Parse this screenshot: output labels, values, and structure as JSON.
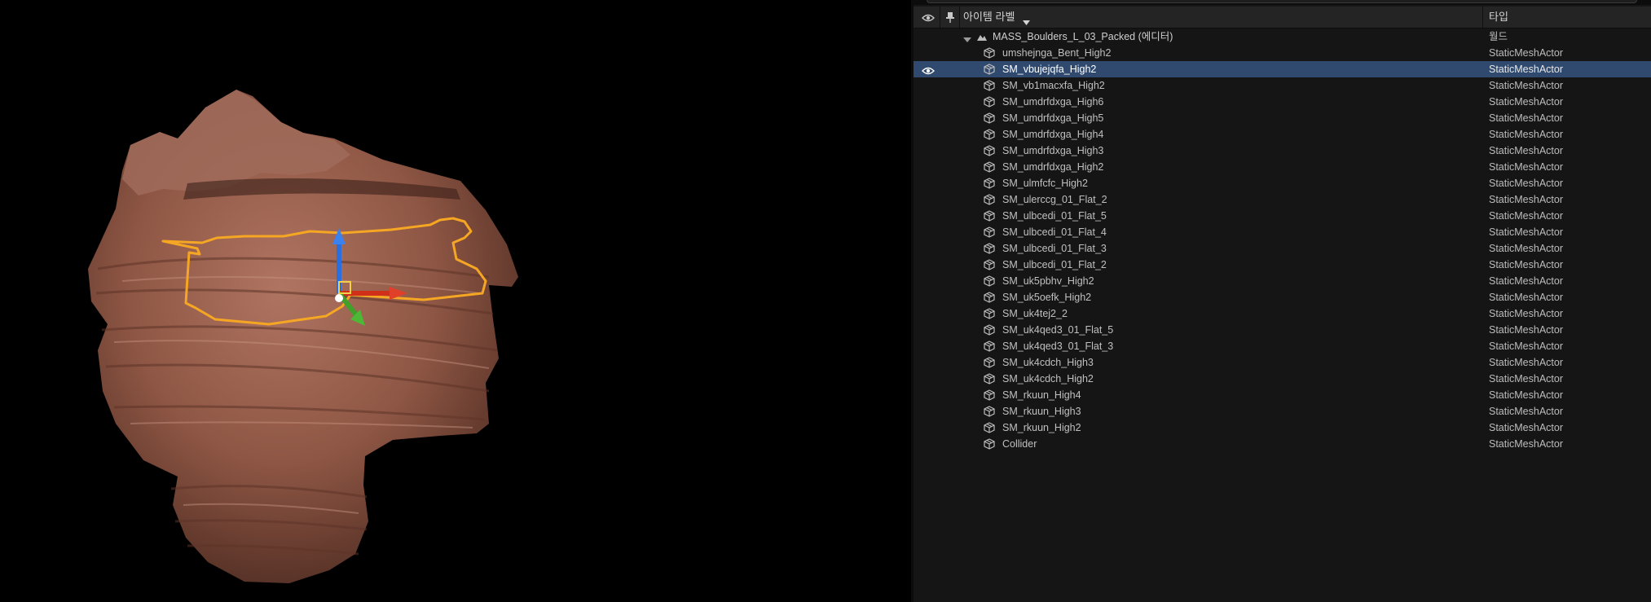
{
  "outliner": {
    "header": {
      "label_column": "아이템 라벨",
      "type_column": "타입"
    },
    "world_row": {
      "label": "MASS_Boulders_L_03_Packed (에디터)",
      "type": "월드"
    },
    "rows": [
      {
        "label": "umshejnga_Bent_High2",
        "type": "StaticMeshActor",
        "selected": false
      },
      {
        "label": "SM_vbujejqfa_High2",
        "type": "StaticMeshActor",
        "selected": true
      },
      {
        "label": "SM_vb1macxfa_High2",
        "type": "StaticMeshActor",
        "selected": false
      },
      {
        "label": "SM_umdrfdxga_High6",
        "type": "StaticMeshActor",
        "selected": false
      },
      {
        "label": "SM_umdrfdxga_High5",
        "type": "StaticMeshActor",
        "selected": false
      },
      {
        "label": "SM_umdrfdxga_High4",
        "type": "StaticMeshActor",
        "selected": false
      },
      {
        "label": "SM_umdrfdxga_High3",
        "type": "StaticMeshActor",
        "selected": false
      },
      {
        "label": "SM_umdrfdxga_High2",
        "type": "StaticMeshActor",
        "selected": false
      },
      {
        "label": "SM_ulmfcfc_High2",
        "type": "StaticMeshActor",
        "selected": false
      },
      {
        "label": "SM_ulerccg_01_Flat_2",
        "type": "StaticMeshActor",
        "selected": false
      },
      {
        "label": "SM_ulbcedi_01_Flat_5",
        "type": "StaticMeshActor",
        "selected": false
      },
      {
        "label": "SM_ulbcedi_01_Flat_4",
        "type": "StaticMeshActor",
        "selected": false
      },
      {
        "label": "SM_ulbcedi_01_Flat_3",
        "type": "StaticMeshActor",
        "selected": false
      },
      {
        "label": "SM_ulbcedi_01_Flat_2",
        "type": "StaticMeshActor",
        "selected": false
      },
      {
        "label": "SM_uk5pbhv_High2",
        "type": "StaticMeshActor",
        "selected": false
      },
      {
        "label": "SM_uk5oefk_High2",
        "type": "StaticMeshActor",
        "selected": false
      },
      {
        "label": "SM_uk4tej2_2",
        "type": "StaticMeshActor",
        "selected": false
      },
      {
        "label": "SM_uk4qed3_01_Flat_5",
        "type": "StaticMeshActor",
        "selected": false
      },
      {
        "label": "SM_uk4qed3_01_Flat_3",
        "type": "StaticMeshActor",
        "selected": false
      },
      {
        "label": "SM_uk4cdch_High3",
        "type": "StaticMeshActor",
        "selected": false
      },
      {
        "label": "SM_uk4cdch_High2",
        "type": "StaticMeshActor",
        "selected": false
      },
      {
        "label": "SM_rkuun_High4",
        "type": "StaticMeshActor",
        "selected": false
      },
      {
        "label": "SM_rkuun_High3",
        "type": "StaticMeshActor",
        "selected": false
      },
      {
        "label": "SM_rkuun_High2",
        "type": "StaticMeshActor",
        "selected": false
      },
      {
        "label": "Collider",
        "type": "StaticMeshActor",
        "selected": false
      }
    ]
  },
  "icons": {
    "visibility": "eye-icon",
    "pin": "pin-icon",
    "sort": "chevron-down-icon",
    "world": "world-icon",
    "mesh": "static-mesh-icon"
  },
  "colors": {
    "selection": "#2f4a6e",
    "selection_outline": "#f5a623",
    "gizmo_x": "#d0301a",
    "gizmo_y": "#3fa02a",
    "gizmo_z": "#2a6fe0"
  }
}
